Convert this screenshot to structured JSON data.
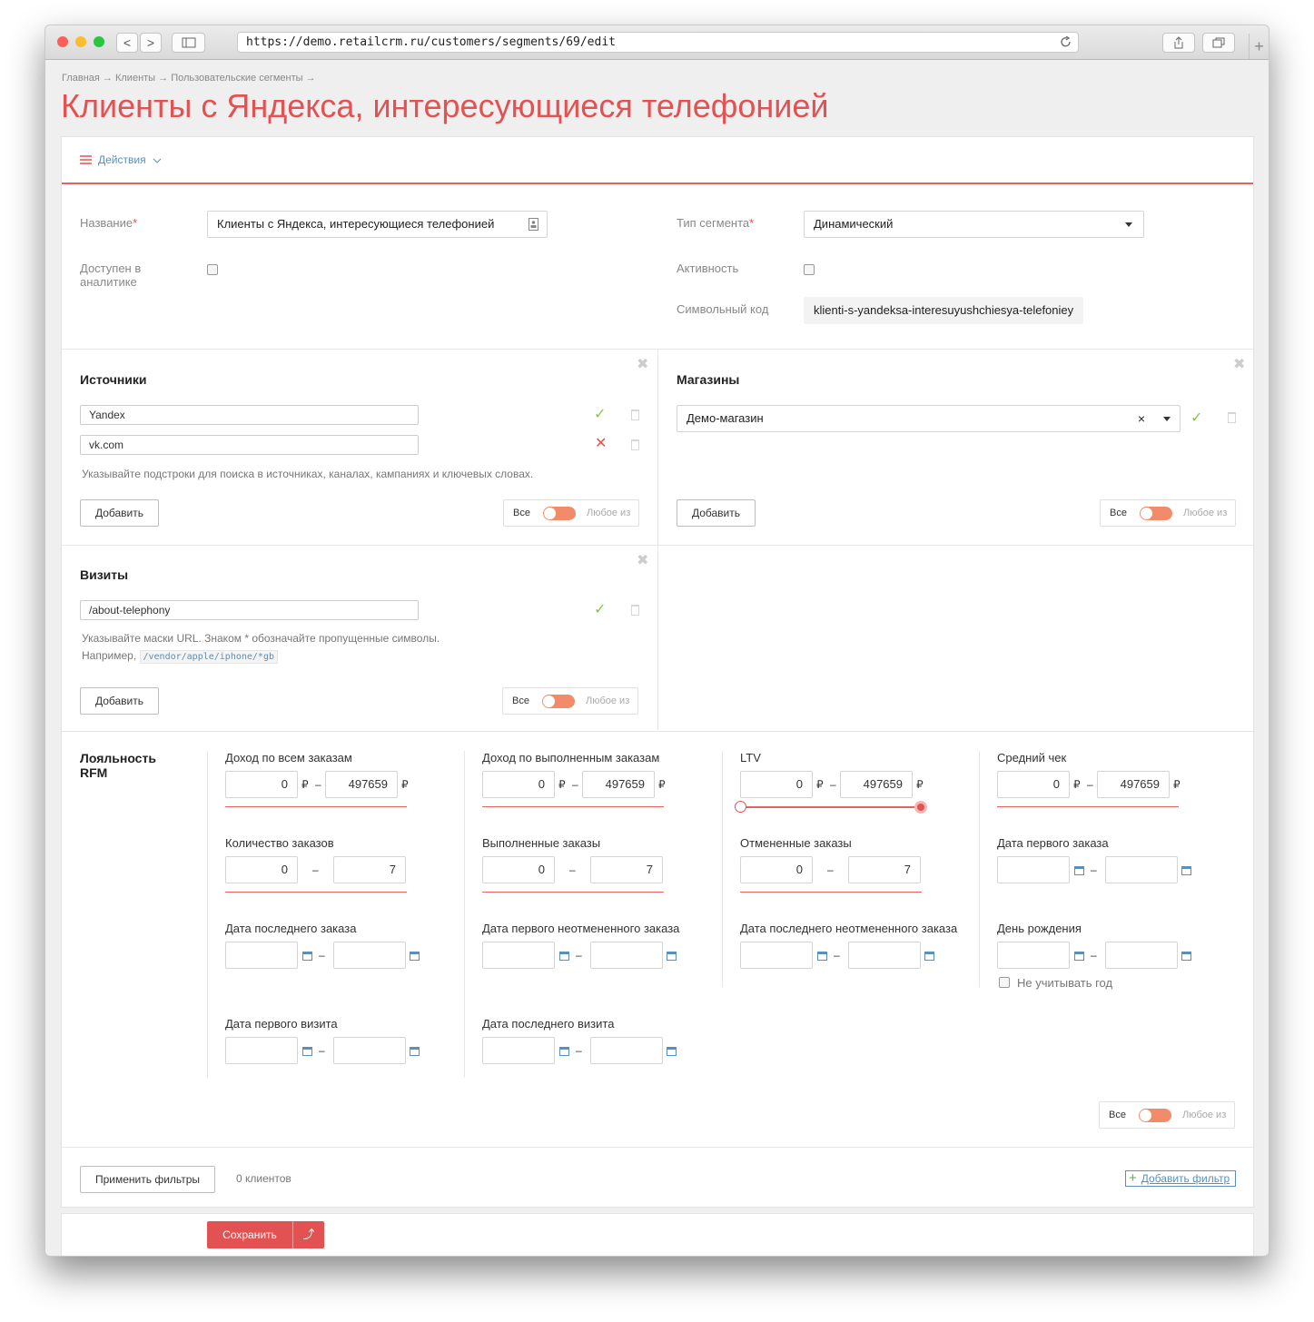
{
  "browser": {
    "url": "https://demo.retailcrm.ru/customers/segments/69/edit",
    "back": "<",
    "forward": ">"
  },
  "page": {
    "breadcrumb": "Главная → Клиенты → Пользовательские сегменты →",
    "title": "Клиенты с Яндекса, интересующиеся телефонией",
    "actions": "Действия"
  },
  "form": {
    "name_label": "Название",
    "name_value": "Клиенты с Яндекса, интересующиеся телефонией",
    "analytics_label_1": "Доступен в",
    "analytics_label_2": "аналитике",
    "type_label": "Тип сегмента",
    "type_value": "Динамический",
    "active_label": "Активность",
    "code_label": "Символьный код",
    "code_value": "klienti-s-yandeksa-interesuyushchiesya-telefoniey",
    "required_mark": "*"
  },
  "sources": {
    "title": "Источники",
    "items": [
      "Yandex",
      "vk.com"
    ],
    "hint": "Указывайте подстроки для поиска в источниках, каналах, кампаниях и ключевых словах.",
    "add": "Добавить"
  },
  "stores": {
    "title": "Магазины",
    "value": "Демо-магазин",
    "clear": "×",
    "add": "Добавить"
  },
  "visits": {
    "title": "Визиты",
    "value": "/about-telephony",
    "hint1": "Указывайте маски URL. Знаком * обозначайте пропущенные символы.",
    "hint2": "Например,",
    "example": "/vendor/apple/iphone/*gb",
    "add": "Добавить"
  },
  "toggle": {
    "all": "Все",
    "any": "Любое из"
  },
  "loyalty": {
    "title_1": "Лояльность",
    "title_2": "RFM",
    "income_all": "Доход по всем заказам",
    "income_done": "Доход по выполненным заказам",
    "ltv": "LTV",
    "avg": "Средний чек",
    "orders_count": "Количество заказов",
    "orders_done": "Выполненные заказы",
    "orders_cancel": "Отмененные заказы",
    "first_order": "Дата первого заказа",
    "last_order": "Дата последнего заказа",
    "first_ok": "Дата первого неотмененного заказа",
    "last_ok": "Дата последнего неотмененного заказа",
    "birthday": "День рождения",
    "first_visit": "Дата первого визита",
    "last_visit": "Дата последнего визита",
    "ignore_year": "Не учитывать год",
    "min": "0",
    "max_money": "497659",
    "max_orders": "7",
    "currency": "₽",
    "dash": "–"
  },
  "footer": {
    "apply": "Применить фильтры",
    "count": "0 клиентов",
    "add_filter": "Добавить фильтр",
    "save": "Сохранить",
    "save_arrow": "⤴"
  },
  "colors": {
    "accent": "#e35252",
    "link": "#5a8fb8",
    "toggle": "#f28b6a"
  }
}
